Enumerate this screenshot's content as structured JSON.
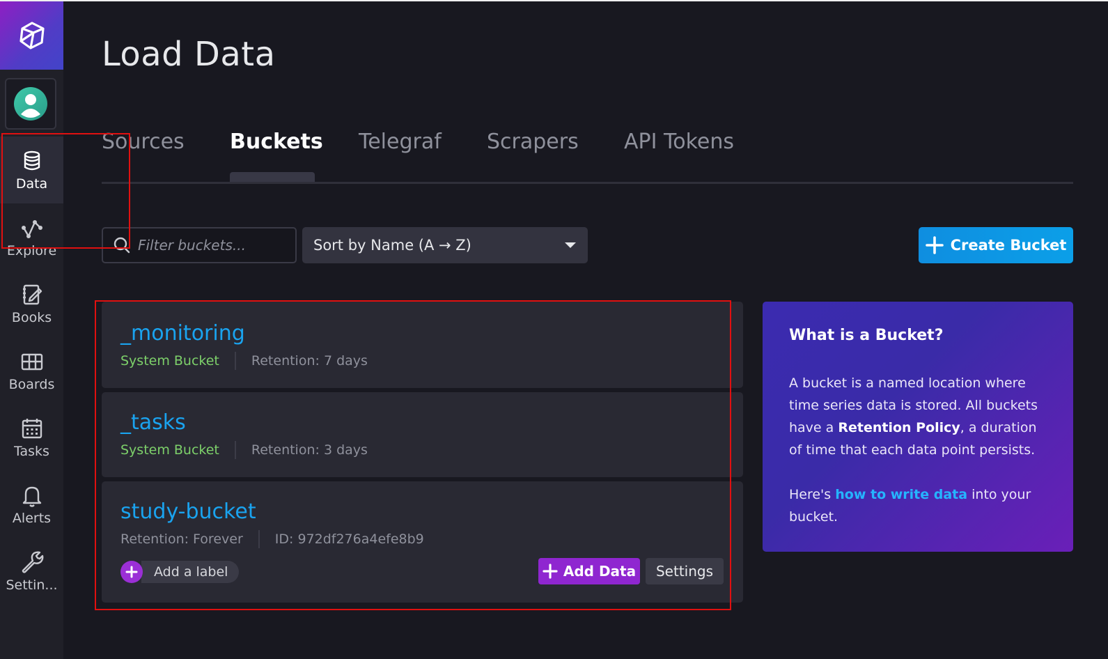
{
  "page": {
    "title": "Load Data"
  },
  "sidebar": {
    "items": [
      {
        "label": "Data",
        "icon": "database-icon"
      },
      {
        "label": "Explore",
        "icon": "graph-icon"
      },
      {
        "label": "Books",
        "icon": "notebook-icon"
      },
      {
        "label": "Boards",
        "icon": "dashboard-grid-icon"
      },
      {
        "label": "Tasks",
        "icon": "calendar-icon"
      },
      {
        "label": "Alerts",
        "icon": "bell-icon"
      },
      {
        "label": "Settin...",
        "icon": "wrench-icon"
      }
    ]
  },
  "tabs": [
    {
      "label": "Sources"
    },
    {
      "label": "Buckets",
      "active": true
    },
    {
      "label": "Telegraf"
    },
    {
      "label": "Scrapers"
    },
    {
      "label": "API Tokens"
    }
  ],
  "toolbar": {
    "filter_placeholder": "Filter buckets...",
    "sort_label": "Sort by Name (A → Z)",
    "create_label": "Create Bucket"
  },
  "buckets": [
    {
      "name": "_monitoring",
      "type": "System Bucket",
      "retention": "Retention: 7 days"
    },
    {
      "name": "_tasks",
      "type": "System Bucket",
      "retention": "Retention: 3 days"
    },
    {
      "name": "study-bucket",
      "retention": "Retention: Forever",
      "id": "ID: 972df276a4efe8b9",
      "add_label": "Add a label",
      "add_data": "Add Data",
      "settings": "Settings"
    }
  ],
  "info": {
    "title": "What is a Bucket?",
    "p1_a": "A bucket is a named location where time series data is stored. All buckets have a ",
    "p1_strong": "Retention Policy",
    "p1_b": ", a duration of time that each data point persists.",
    "p2_a": "Here's ",
    "p2_link": "how to write data",
    "p2_b": " into your bucket."
  },
  "colors": {
    "accent_blue": "#1aa3ef",
    "system_green": "#7dd06a",
    "purple": "#8f26d0",
    "annotation_red": "#e01010"
  }
}
